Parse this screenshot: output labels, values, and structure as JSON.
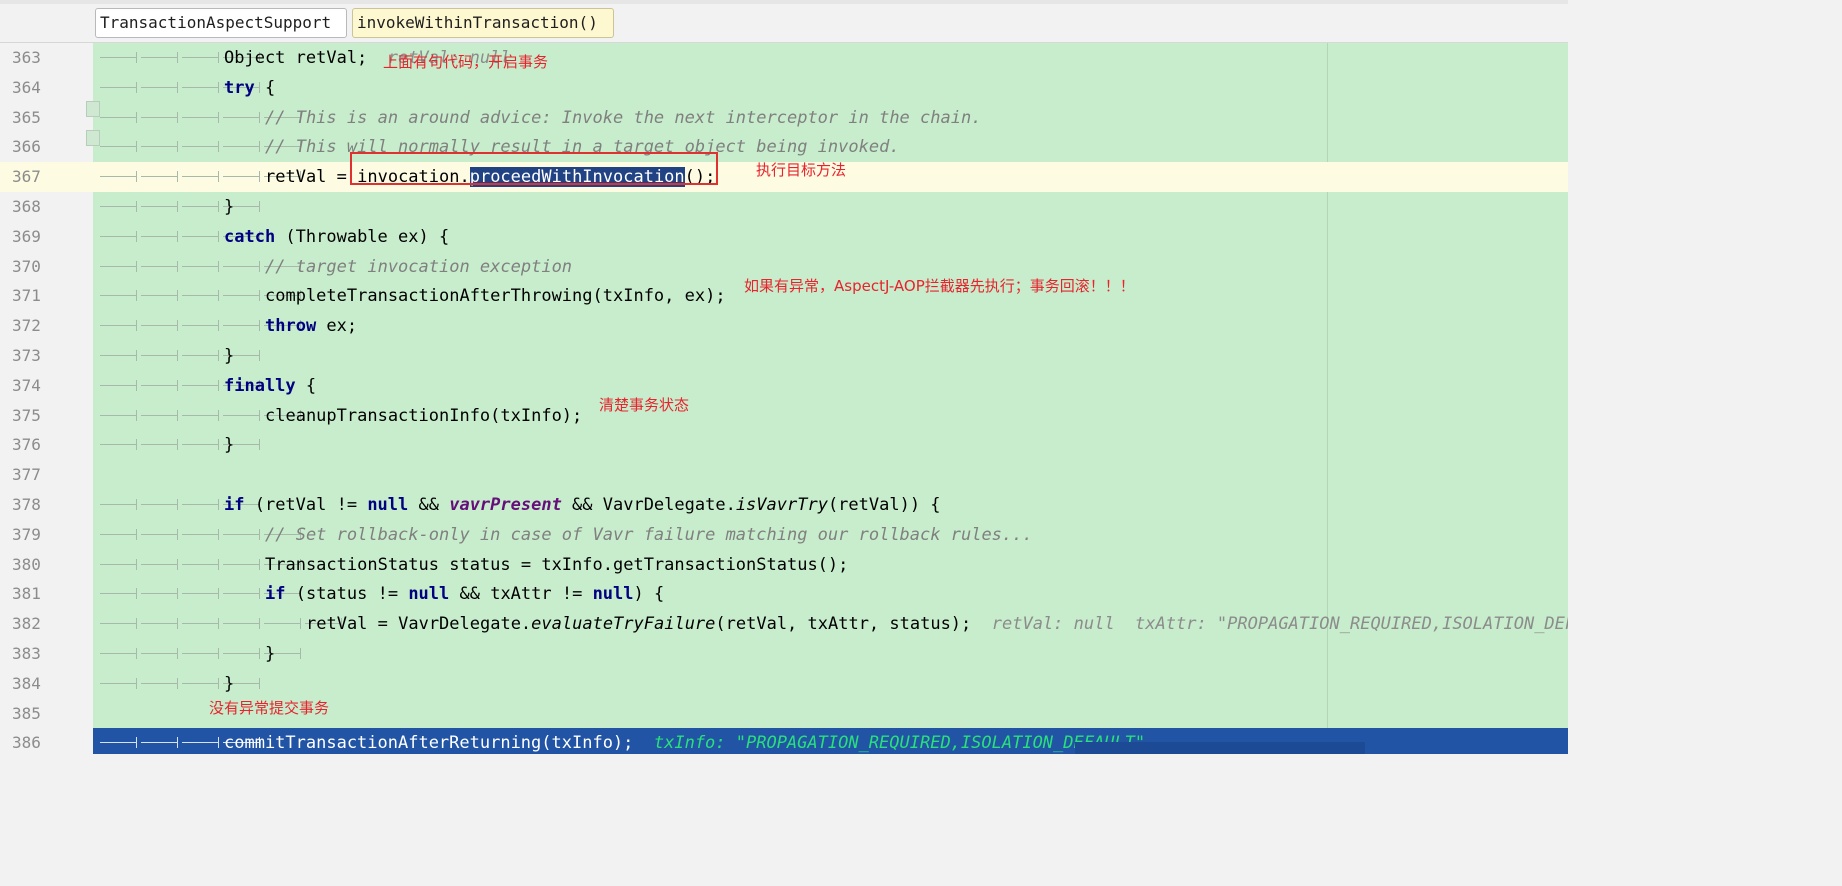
{
  "breadcrumbs": [
    "TransactionAspectSupport",
    "invokeWithinTransaction()"
  ],
  "lines": [
    {
      "no": "363",
      "segs": [
        [
          "Object retVal;",
          ""
        ],
        [
          "  retVal: null",
          "hint"
        ]
      ]
    },
    {
      "no": "364",
      "segs": [
        [
          "try",
          "kw"
        ],
        [
          " {",
          ""
        ]
      ]
    },
    {
      "no": "365",
      "segs": [
        [
          "// This is an around advice: Invoke the next interceptor in the chain.",
          "cm"
        ]
      ]
    },
    {
      "no": "366",
      "segs": [
        [
          "// This will normally result in a target object being invoked.",
          "cm"
        ]
      ]
    },
    {
      "no": "367",
      "segs": [
        [
          "retVal = ",
          ""
        ],
        [
          "invocation.",
          ""
        ],
        [
          "proceedWithInvocation",
          "sel"
        ],
        [
          "();",
          ""
        ]
      ]
    },
    {
      "no": "368",
      "segs": [
        [
          "}",
          ""
        ]
      ]
    },
    {
      "no": "369",
      "segs": [
        [
          "catch",
          "kw"
        ],
        [
          " (Throwable ex) {",
          ""
        ]
      ]
    },
    {
      "no": "370",
      "segs": [
        [
          "// target invocation exception",
          "cm"
        ]
      ]
    },
    {
      "no": "371",
      "segs": [
        [
          "completeTransactionAfterThrowing(txInfo, ex);",
          ""
        ]
      ]
    },
    {
      "no": "372",
      "segs": [
        [
          "throw",
          "kw"
        ],
        [
          " ex;",
          ""
        ]
      ]
    },
    {
      "no": "373",
      "segs": [
        [
          "}",
          ""
        ]
      ]
    },
    {
      "no": "374",
      "segs": [
        [
          "finally",
          "kw"
        ],
        [
          " {",
          ""
        ]
      ]
    },
    {
      "no": "375",
      "segs": [
        [
          "cleanupTransactionInfo(txInfo);",
          ""
        ]
      ]
    },
    {
      "no": "376",
      "segs": [
        [
          "}",
          ""
        ]
      ]
    },
    {
      "no": "377",
      "segs": []
    },
    {
      "no": "378",
      "segs": [
        [
          "if",
          "kw"
        ],
        [
          " (retVal != ",
          ""
        ],
        [
          "null",
          "kw"
        ],
        [
          " && ",
          ""
        ],
        [
          "vavrPresent",
          "fld"
        ],
        [
          " && VavrDelegate.",
          ""
        ],
        [
          "isVavrTry",
          "it"
        ],
        [
          "(retVal)) {",
          ""
        ]
      ]
    },
    {
      "no": "379",
      "segs": [
        [
          "// Set rollback-only in case of Vavr failure matching our rollback rules...",
          "cm"
        ]
      ]
    },
    {
      "no": "380",
      "segs": [
        [
          "TransactionStatus status = txInfo.getTransactionStatus();",
          ""
        ]
      ]
    },
    {
      "no": "381",
      "segs": [
        [
          "if",
          "kw"
        ],
        [
          " (status != ",
          ""
        ],
        [
          "null",
          "kw"
        ],
        [
          " && txAttr != ",
          ""
        ],
        [
          "null",
          "kw"
        ],
        [
          ") {",
          ""
        ]
      ]
    },
    {
      "no": "382",
      "segs": [
        [
          "retVal = VavrDelegate.",
          ""
        ],
        [
          "evaluateTryFailure",
          "it"
        ],
        [
          "(retVal, txAttr, status);",
          ""
        ],
        [
          "  retVal: null  txAttr: \"PROPAGATION_REQUIRED,ISOLATION_DEFAULT\"",
          "hint"
        ]
      ]
    },
    {
      "no": "383",
      "segs": [
        [
          "}",
          ""
        ]
      ]
    },
    {
      "no": "384",
      "segs": [
        [
          "}",
          ""
        ]
      ]
    },
    {
      "no": "385",
      "segs": []
    },
    {
      "no": "386",
      "segs": [
        [
          "commitTransactionAfterReturning(txInfo);",
          ""
        ],
        [
          "  txInfo: \"PROPAGATION_REQUIRED,ISOLATION_DEFAULT\"",
          "hint"
        ]
      ]
    }
  ],
  "annotations": {
    "open_tx": "上面有句代码，开启事务",
    "invoke_target": "执行目标方法",
    "rollback": "如果有异常，AspectJ-AOP拦截器先执行；事务回滚！！！",
    "cleanup": "清楚事务状态",
    "commit": "没有异常提交事务"
  },
  "colors": {
    "code_bg": "#c7edcc",
    "current_line_bg": "#fdfbe2",
    "execution_line_bg": "#2154a5",
    "annotation_red": "#e8232d",
    "keyword_blue": "#000080"
  }
}
